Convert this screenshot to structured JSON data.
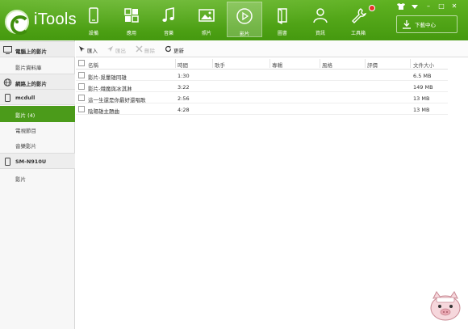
{
  "app": {
    "name": "iTools"
  },
  "nav": [
    {
      "label": "設備",
      "icon": "phone-icon"
    },
    {
      "label": "應用",
      "icon": "apps-grid-icon"
    },
    {
      "label": "音樂",
      "icon": "music-note-icon"
    },
    {
      "label": "照片",
      "icon": "photo-icon"
    },
    {
      "label": "影片",
      "icon": "play-circle-icon",
      "active": true
    },
    {
      "label": "圖書",
      "icon": "book-icon"
    },
    {
      "label": "資訊",
      "icon": "person-icon"
    },
    {
      "label": "工具箱",
      "icon": "wrench-icon"
    }
  ],
  "window_controls": {
    "shirt": "👕",
    "minimize": "–",
    "maximize": "□",
    "close": "✕"
  },
  "download": {
    "label": "下載中心",
    "icon": "download-icon"
  },
  "sidebar": {
    "groups": [
      {
        "label": "電腦上的影片",
        "icon": "monitor-icon",
        "items": [
          "影片資料庫"
        ]
      },
      {
        "label": "網路上的影片",
        "icon": "globe-icon",
        "items": []
      },
      {
        "label": "mcdull",
        "icon": "device-icon",
        "items": [
          "影片 (4)",
          "電視節目",
          "音樂影片"
        ],
        "active_item": "影片 (4)"
      },
      {
        "label": "SM-N910U",
        "icon": "device-icon",
        "items": [
          "影片"
        ]
      }
    ]
  },
  "toolbar": {
    "import": "匯入",
    "export": "匯出",
    "delete": "刪除",
    "refresh": "更新"
  },
  "table": {
    "columns": [
      "名稱",
      "時間",
      "歌手",
      "專輯",
      "風格",
      "評價",
      "文件大小"
    ],
    "rows": [
      {
        "name": "影片-覓暈雄同雄",
        "time": "1:30",
        "artist": "",
        "album": "",
        "genre": "",
        "rating": "",
        "size": "6.5 MB"
      },
      {
        "name": "影片-熾魔與冰淇淋",
        "time": "3:22",
        "artist": "",
        "album": "",
        "genre": "",
        "rating": "",
        "size": "149 MB"
      },
      {
        "name": "這一生還是你最好還唱歌",
        "time": "2:56",
        "artist": "",
        "album": "",
        "genre": "",
        "rating": "",
        "size": "13 MB"
      },
      {
        "name": "陰陽雄主題曲",
        "time": "4:28",
        "artist": "",
        "album": "",
        "genre": "",
        "rating": "",
        "size": "13 MB"
      }
    ]
  },
  "colors": {
    "brand_green": "#4b9b1a",
    "header_green": "#52a716"
  }
}
